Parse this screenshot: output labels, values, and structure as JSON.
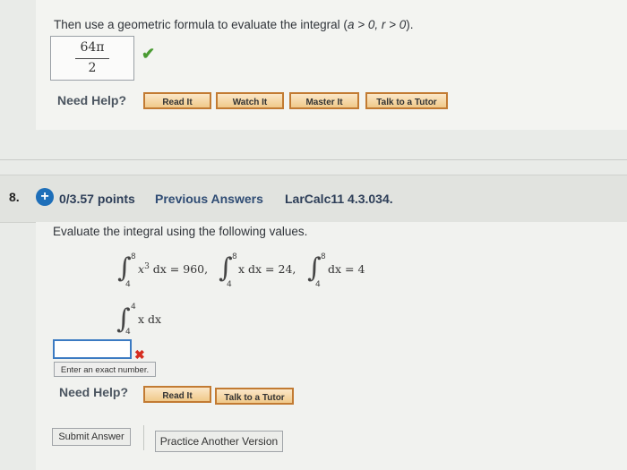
{
  "previous": {
    "prompt_prefix": "Then use a geometric formula to evaluate the integral (",
    "prompt_cond": "a > 0, r > 0",
    "prompt_suffix": ").",
    "answer_numerator": "64π",
    "answer_denominator": "2",
    "check_icon": "checkmark-icon",
    "need_help": "Need Help?",
    "buttons": [
      "Read It",
      "Watch It",
      "Master It",
      "Talk to a Tutor"
    ]
  },
  "question": {
    "number": "8.",
    "points": "0/3.57 points",
    "previous_answers": "Previous Answers",
    "code": "LarCalc11 4.3.034.",
    "prompt": "Evaluate the integral using the following values.",
    "given": [
      {
        "integrand": "x",
        "power": "3",
        "rest": " dx = 960,",
        "upper": "8",
        "lower": "4"
      },
      {
        "integrand": "x dx = 24,",
        "upper": "8",
        "lower": "4"
      },
      {
        "integrand": "dx = 4",
        "upper": "8",
        "lower": "4"
      }
    ],
    "target": {
      "integrand": "x dx",
      "upper": "4",
      "lower": "4"
    },
    "input_value": "",
    "wrong_icon": "x-icon",
    "hint": "Enter an exact number.",
    "need_help": "Need Help?",
    "buttons": [
      "Read It",
      "Talk to a Tutor"
    ],
    "submit": "Submit Answer",
    "practice": "Practice Another Version"
  },
  "colors": {
    "accent": "#1e6fb9",
    "correct": "#4a9b33",
    "wrong": "#d62d20",
    "help_button_border": "#c27b33"
  }
}
